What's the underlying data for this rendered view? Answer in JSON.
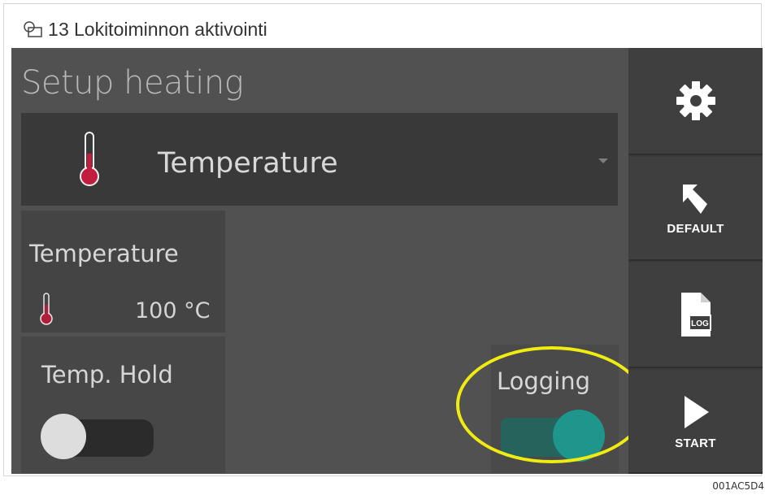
{
  "caption": {
    "number": "13",
    "title": "Lokitoiminnon aktivointi",
    "icon": "figure-icon"
  },
  "screen": {
    "title": "Setup heating",
    "mode_selector": {
      "value": "Temperature",
      "icon": "thermometer-icon"
    },
    "temperature_setting": {
      "label": "Temperature",
      "value": "100",
      "unit": "°C",
      "icon": "thermometer-icon"
    },
    "temp_hold": {
      "label": "Temp. Hold",
      "state": "off"
    },
    "logging": {
      "label": "Logging",
      "state": "on",
      "toggle_color": "#1f968b",
      "highlight_color": "#f0ec12"
    }
  },
  "side_panel": {
    "buttons": [
      {
        "name": "settings",
        "label": "",
        "icon": "gear-icon"
      },
      {
        "name": "default",
        "label": "DEFAULT",
        "icon": "undo-arrow-icon"
      },
      {
        "name": "log",
        "label": "",
        "icon": "log-document-icon"
      },
      {
        "name": "start",
        "label": "START",
        "icon": "play-icon"
      }
    ]
  },
  "footer_code": "001AC5D4"
}
